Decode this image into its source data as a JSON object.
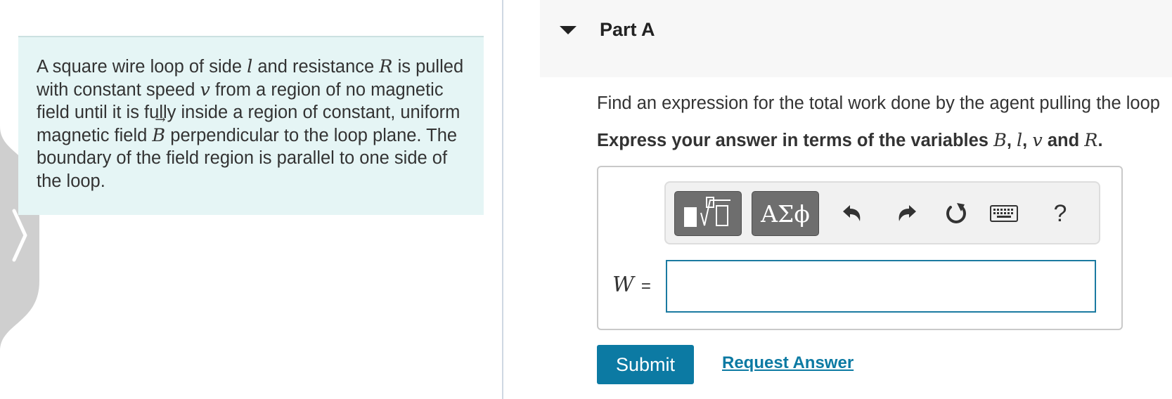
{
  "problem": {
    "t1": "A square wire loop of side ",
    "v_l": "l",
    "t2": " and resistance ",
    "v_R": "R",
    "t3": " is pulled with constant speed ",
    "v_v": "v",
    "t4": " from a region of no magnetic field until it is fully inside a region of constant, uniform magnetic field ",
    "v_B": "B",
    "t5": " perpendicular to the loop plane. The boundary of the field region is parallel to one side of the loop."
  },
  "part": {
    "title": "Part A"
  },
  "question": {
    "text": "Find an expression for the total work done by the agent pulling the loop"
  },
  "instruction": {
    "prefix": "Express your answer in terms of the variables ",
    "var1": "B",
    "sep1": ", ",
    "var2": "l",
    "sep2": ", ",
    "var3": "v",
    "and": " and ",
    "var4": "R",
    "suffix": "."
  },
  "toolbar": {
    "greek_label": "ΑΣϕ",
    "help_label": "?"
  },
  "answer": {
    "variable": "W",
    "equals": "=",
    "value": ""
  },
  "actions": {
    "submit_label": "Submit",
    "request_label": "Request Answer"
  },
  "colors": {
    "accent": "#0c7aa3",
    "problem_bg": "#e5f5f5",
    "header_bg": "#f7f7f7",
    "toolbar_btn": "#6e6e6e"
  },
  "icons": {
    "side_handle": "chevron-right-icon",
    "toggle": "caret-down-icon",
    "templates": "templates-icon",
    "undo": "undo-icon",
    "redo": "redo-icon",
    "reset": "reset-icon",
    "keyboard": "keyboard-icon"
  }
}
